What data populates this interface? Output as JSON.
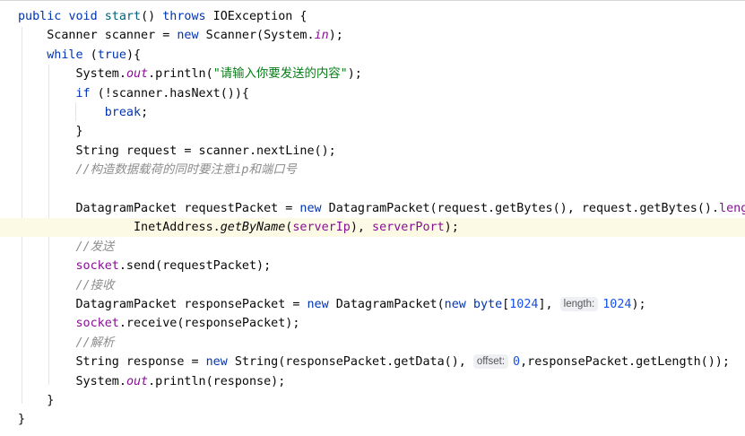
{
  "editor": {
    "lines": [
      [
        {
          "t": "public",
          "c": "kw"
        },
        {
          "t": " "
        },
        {
          "t": "void",
          "c": "kw"
        },
        {
          "t": " "
        },
        {
          "t": "start",
          "c": "fn"
        },
        {
          "t": "() "
        },
        {
          "t": "throws",
          "c": "kw"
        },
        {
          "t": " IOException {"
        }
      ],
      [
        {
          "t": "    Scanner scanner = "
        },
        {
          "t": "new",
          "c": "kw"
        },
        {
          "t": " Scanner(System."
        },
        {
          "t": "in",
          "c": "sf"
        },
        {
          "t": ");"
        }
      ],
      [
        {
          "t": "    "
        },
        {
          "t": "while",
          "c": "kw"
        },
        {
          "t": " ("
        },
        {
          "t": "true",
          "c": "kw"
        },
        {
          "t": "){"
        }
      ],
      [
        {
          "t": "        System."
        },
        {
          "t": "out",
          "c": "sf"
        },
        {
          "t": ".println("
        },
        {
          "t": "\"请输入你要发送的内容\"",
          "c": "str"
        },
        {
          "t": ");"
        }
      ],
      [
        {
          "t": "        "
        },
        {
          "t": "if",
          "c": "kw"
        },
        {
          "t": " (!scanner.hasNext()){"
        }
      ],
      [
        {
          "t": "            "
        },
        {
          "t": "break",
          "c": "kw"
        },
        {
          "t": ";"
        }
      ],
      [
        {
          "t": "        }"
        }
      ],
      [
        {
          "t": "        String request = scanner.nextLine();"
        }
      ],
      [
        {
          "t": "        "
        },
        {
          "t": "//构造数据载荷的同时要注意ip和端口号",
          "c": "cm"
        }
      ],
      [],
      [
        {
          "t": "        DatagramPacket requestPacket = "
        },
        {
          "t": "new",
          "c": "kw"
        },
        {
          "t": " DatagramPacket(request.getBytes(), request.getBytes()."
        },
        {
          "t": "length",
          "c": "fld"
        },
        {
          "t": ","
        }
      ],
      [
        {
          "t": "                InetAddress."
        },
        {
          "t": "getByName",
          "c": "st"
        },
        {
          "t": "("
        },
        {
          "t": "serverIp",
          "c": "fld"
        },
        {
          "t": "), "
        },
        {
          "t": "serverPort",
          "c": "fld"
        },
        {
          "t": ");"
        }
      ],
      [
        {
          "t": "        "
        },
        {
          "t": "//发送",
          "c": "cm"
        }
      ],
      [
        {
          "t": "        "
        },
        {
          "t": "socket",
          "c": "fld"
        },
        {
          "t": ".send(requestPacket);"
        }
      ],
      [
        {
          "t": "        "
        },
        {
          "t": "//接收",
          "c": "cm"
        }
      ],
      [
        {
          "t": "        DatagramPacket responsePacket = "
        },
        {
          "t": "new",
          "c": "kw"
        },
        {
          "t": " DatagramPacket("
        },
        {
          "t": "new",
          "c": "kw"
        },
        {
          "t": " "
        },
        {
          "t": "byte",
          "c": "kw"
        },
        {
          "t": "["
        },
        {
          "t": "1024",
          "c": "num"
        },
        {
          "t": "], "
        },
        {
          "hint": "length:"
        },
        {
          "t": "1024",
          "c": "num"
        },
        {
          "t": ");"
        }
      ],
      [
        {
          "t": "        "
        },
        {
          "t": "socket",
          "c": "fld"
        },
        {
          "t": ".receive(responsePacket);"
        }
      ],
      [
        {
          "t": "        "
        },
        {
          "t": "//解析",
          "c": "cm"
        }
      ],
      [
        {
          "t": "        String response = "
        },
        {
          "t": "new",
          "c": "kw"
        },
        {
          "t": " String(responsePacket.getData(), "
        },
        {
          "hint": "offset:"
        },
        {
          "t": "0",
          "c": "num"
        },
        {
          "t": ",responsePacket.getLength());"
        }
      ],
      [
        {
          "t": "        System."
        },
        {
          "t": "out",
          "c": "sf"
        },
        {
          "t": ".println(response);"
        }
      ],
      [
        {
          "t": "    }"
        }
      ],
      [
        {
          "t": "}"
        }
      ]
    ]
  }
}
